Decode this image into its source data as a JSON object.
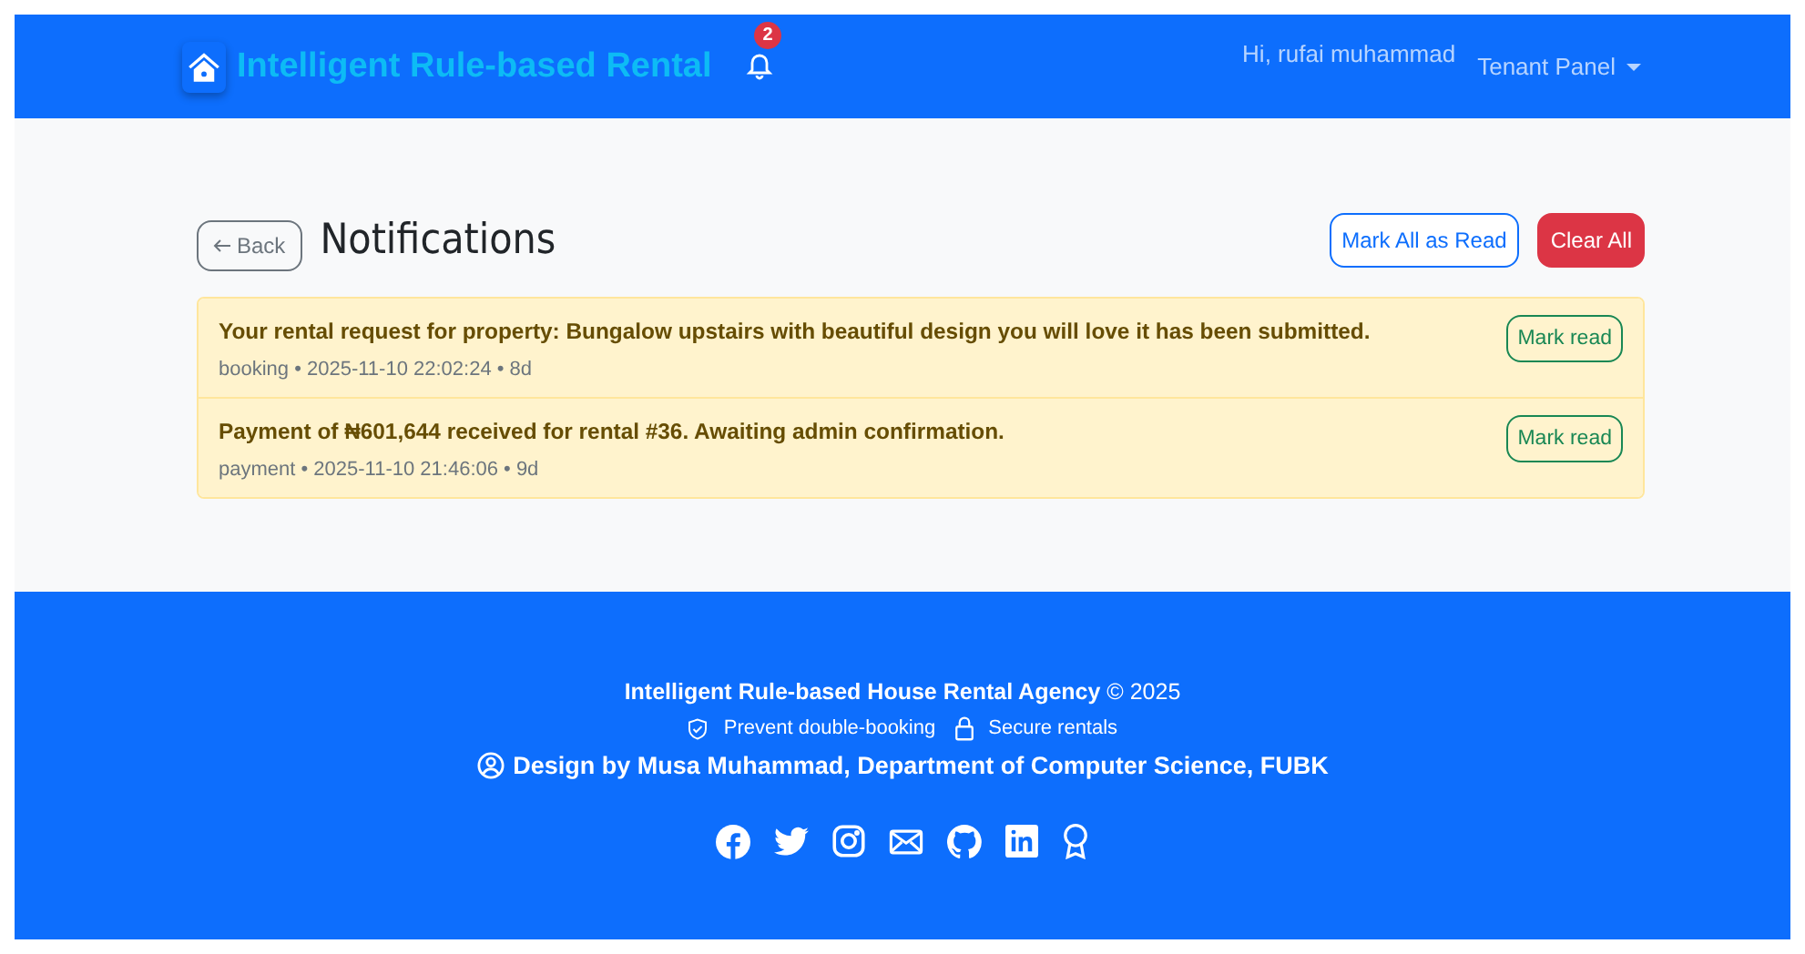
{
  "navbar": {
    "brand": "Intelligent Rule-based Rental",
    "notification_count": "2",
    "greeting": "Hi, rufai muhammad",
    "menu": "Tenant Panel"
  },
  "page": {
    "back": "Back",
    "title": "Notifications",
    "actions": [
      {
        "kind": "outline",
        "label": "Mark All as Read"
      },
      {
        "kind": "danger",
        "label": "Clear All"
      }
    ]
  },
  "notifications": [
    {
      "message": "Your rental request for property: Bungalow upstairs with beautiful design you will love it has been submitted.",
      "meta": "booking • 2025-11-10 22:02:24 • 8d",
      "action": "Mark read",
      "unread": true
    },
    {
      "message": "Payment of ₦601,644 received for rental #36. Awaiting admin confirmation.",
      "meta": "payment • 2025-11-10 21:46:06 • 9d",
      "action": "Mark read",
      "unread": true
    }
  ],
  "footer": {
    "credit": "**Intelligent Rule-based House Rental Agency** © 2025",
    "features": [
      {
        "kind": "shield",
        "label": "Prevent double-booking"
      },
      {
        "kind": "lock",
        "label": "Secure rentals"
      }
    ],
    "designer": "Design by Musa Muhammad, Department of Computer Science, FUBK",
    "social": [
      {
        "kind": "facebook"
      },
      {
        "kind": "twitter"
      },
      {
        "kind": "instagram"
      },
      {
        "kind": "mail"
      },
      {
        "kind": "github"
      },
      {
        "kind": "linkedin"
      },
      {
        "kind": "award"
      }
    ]
  }
}
